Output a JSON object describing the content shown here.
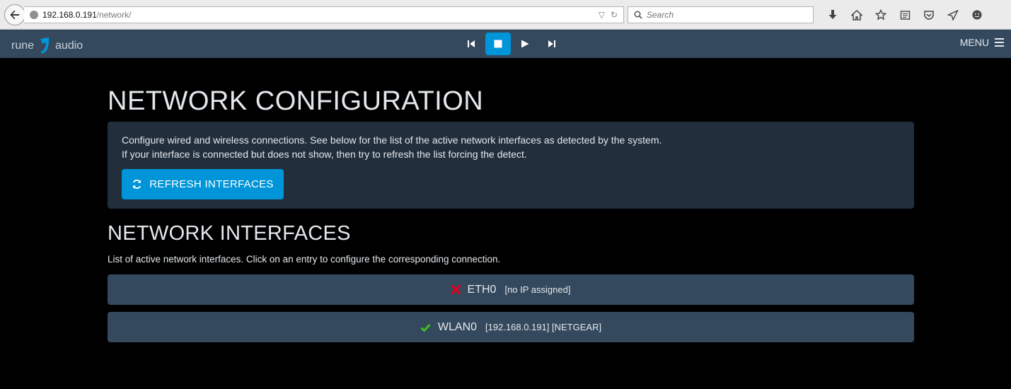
{
  "browser": {
    "url_host": "192.168.0.191",
    "url_path": "/network/",
    "search_placeholder": "Search"
  },
  "app": {
    "logo_left": "rune",
    "logo_right": "audio",
    "menu_label": "MENU"
  },
  "page": {
    "title": "NETWORK CONFIGURATION",
    "intro_line1": "Configure wired and wireless connections. See below for the list of the active network interfaces as detected by the system.",
    "intro_line2": "If your interface is connected but does not show, then try to refresh the list forcing the detect.",
    "refresh_label": "REFRESH INTERFACES",
    "interfaces_title": "NETWORK INTERFACES",
    "interfaces_desc": "List of active network interfaces. Click on an entry to configure the corresponding connection.",
    "interfaces": [
      {
        "name": "ETH0",
        "detail": "[no IP assigned]",
        "status": "disconnected",
        "status_color": "#e0001b"
      },
      {
        "name": "WLAN0",
        "detail": "[192.168.0.191] [NETGEAR]",
        "status": "connected",
        "status_color": "#3ec21a"
      }
    ]
  },
  "colors": {
    "accent": "#0095d8",
    "navbar": "#34495e",
    "panel": "#212e3b"
  }
}
